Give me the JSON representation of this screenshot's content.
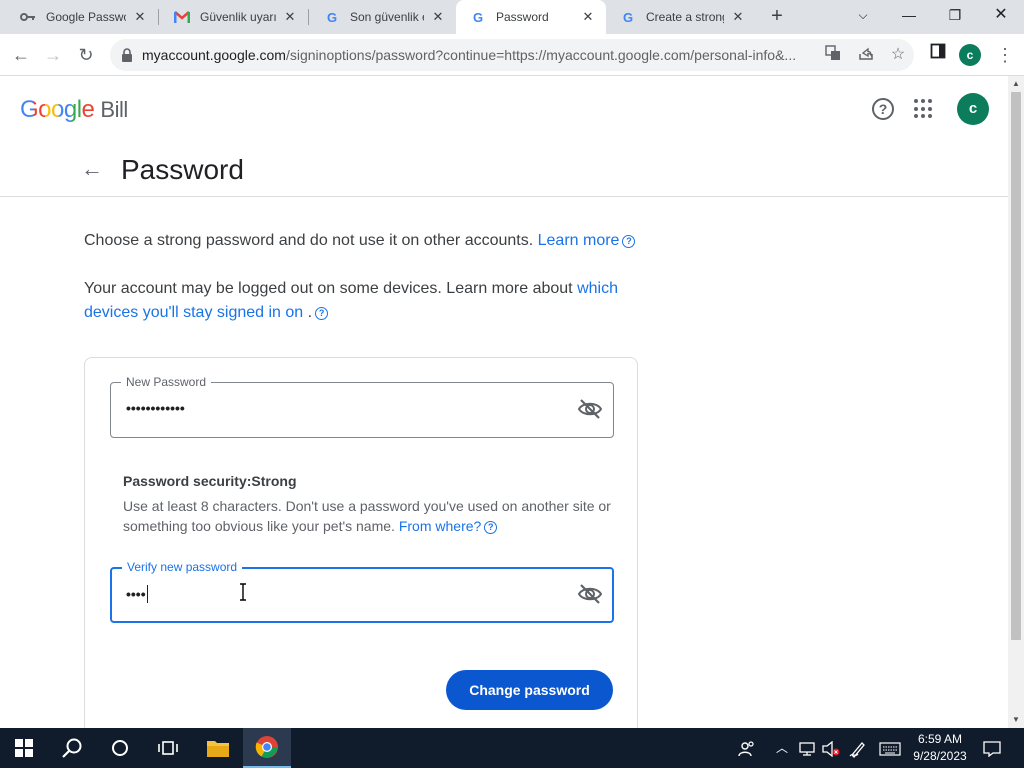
{
  "browser": {
    "tabs": [
      {
        "title": "Google Password Manager",
        "favicon": "key-icon",
        "active": false
      },
      {
        "title": "Güvenlik uyarısı",
        "favicon": "gmail-icon",
        "active": false
      },
      {
        "title": "Son güvenlik etkinliği",
        "favicon": "google-icon",
        "active": false
      },
      {
        "title": "Password",
        "favicon": "google-icon",
        "active": true
      },
      {
        "title": "Create a strong password",
        "favicon": "google-icon",
        "active": false
      }
    ],
    "url_host": "myaccount.google.com",
    "url_path": "/signinoptions/password?continue=https://myaccount.google.com/personal-info&...",
    "profile_initial": "c"
  },
  "header": {
    "logo_text": "Google",
    "product": "Bill",
    "avatar_initial": "c"
  },
  "page": {
    "title": "Password",
    "intro": "Choose a strong password and do not use it on other accounts.",
    "intro_link": "Learn more",
    "logout_text": "Your account may be logged out on some devices. Learn more about",
    "logout_link": "which devices you'll stay signed in on",
    "logout_suffix": "."
  },
  "form": {
    "new_password_label": "New Password",
    "new_password_value": "••••••••••••",
    "security_title": "Password security:Strong",
    "security_desc": "Use at least 8 characters. Don't use a password you've used on another site or something too obvious like your pet's name.",
    "security_link": "From where?",
    "verify_label": "Verify new password",
    "verify_value": "••••",
    "submit_label": "Change password"
  },
  "taskbar": {
    "time": "6:59 AM",
    "date": "9/28/2023"
  },
  "colors": {
    "accent": "#1a73e8",
    "primary_button": "#0b57d0",
    "avatar": "#0b7d5c",
    "taskbar": "#101c2c"
  }
}
